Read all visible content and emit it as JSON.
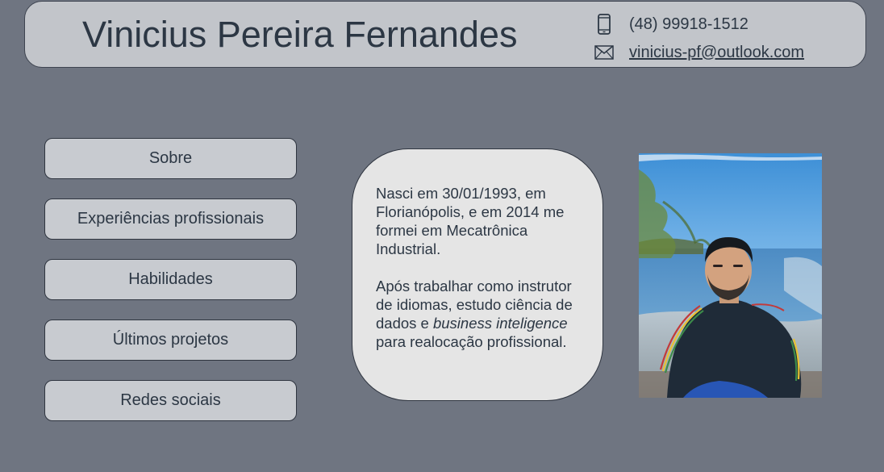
{
  "header": {
    "name": "Vinicius Pereira Fernandes",
    "phone": "(48) 99918-1512",
    "email": "vinicius-pf@outlook.com",
    "phone_icon": "smartphone-icon",
    "email_icon": "envelope-icon"
  },
  "nav": {
    "items": [
      {
        "label": "Sobre"
      },
      {
        "label": "Experiências profissionais"
      },
      {
        "label": "Habilidades"
      },
      {
        "label": "Últimos projetos"
      },
      {
        "label": "Redes sociais"
      }
    ]
  },
  "about": {
    "paragraph1": "Nasci em 30/01/1993, em Florianópolis, e em 2014 me formei em Mecatrônica Industrial.",
    "paragraph2_before": "Após trabalhar como instrutor de idiomas, estudo ciência de dados e ",
    "paragraph2_italic": "business inteligence",
    "paragraph2_after": " para realocação profissional."
  },
  "colors": {
    "background": "#6f7581",
    "panel": "#c2c5ca",
    "button": "#c8cbd0",
    "card": "#e5e5e5",
    "text": "#2c3744"
  }
}
